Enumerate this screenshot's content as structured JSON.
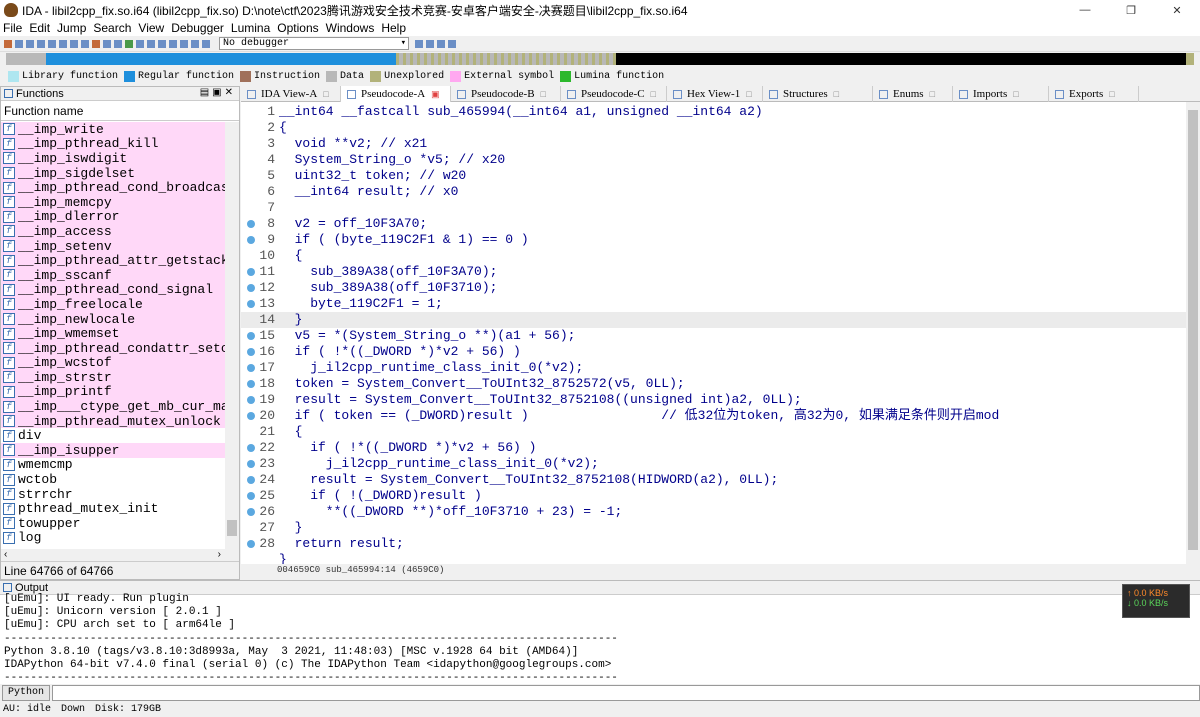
{
  "window": {
    "title": "IDA - libil2cpp_fix.so.i64 (libil2cpp_fix.so) D:\\note\\ctf\\2023腾讯游戏安全技术竞赛-安卓客户端安全-决赛题目\\libil2cpp_fix.so.i64"
  },
  "menu": [
    "File",
    "Edit",
    "Jump",
    "Search",
    "View",
    "Debugger",
    "Lumina",
    "Options",
    "Windows",
    "Help"
  ],
  "toolbar": {
    "debugger_select": "No debugger"
  },
  "legend": [
    {
      "label": "Library function",
      "color": "#aee6f0"
    },
    {
      "label": "Regular function",
      "color": "#1e8fdc"
    },
    {
      "label": "Instruction",
      "color": "#a0705a"
    },
    {
      "label": "Data",
      "color": "#b8b8b8"
    },
    {
      "label": "Unexplored",
      "color": "#b2b27a"
    },
    {
      "label": "External symbol",
      "color": "#ffa8f0"
    },
    {
      "label": "Lumina function",
      "color": "#2cb82c"
    }
  ],
  "functions_panel": {
    "title": "Functions",
    "column": "Function name",
    "items": [
      "__imp_write",
      "__imp_pthread_kill",
      "__imp_iswdigit",
      "__imp_sigdelset",
      "__imp_pthread_cond_broadcast",
      "__imp_memcpy",
      "__imp_dlerror",
      "__imp_access",
      "__imp_setenv",
      "__imp_pthread_attr_getstack",
      "__imp_sscanf",
      "__imp_pthread_cond_signal",
      "__imp_freelocale",
      "__imp_newlocale",
      "__imp_wmemset",
      "__imp_pthread_condattr_setcl",
      "__imp_wcstof",
      "__imp_strstr",
      "__imp_printf",
      "__imp___ctype_get_mb_cur_max",
      "__imp_pthread_mutex_unlock",
      "div",
      "__imp_isupper",
      "wmemcmp",
      "wctob",
      "strrchr",
      "pthread_mutex_init",
      "towupper",
      "log"
    ],
    "status": "Line 64766 of 64766"
  },
  "tabs": [
    {
      "label": "IDA View-A"
    },
    {
      "label": "Pseudocode-A"
    },
    {
      "label": "Pseudocode-B"
    },
    {
      "label": "Pseudocode-C"
    },
    {
      "label": "Hex View-1"
    },
    {
      "label": "Structures"
    },
    {
      "label": "Enums"
    },
    {
      "label": "Imports"
    },
    {
      "label": "Exports"
    }
  ],
  "code_lines": [
    {
      "n": "1",
      "t": "__int64 __fastcall sub_465994(__int64 a1, unsigned __int64 a2)"
    },
    {
      "n": "2",
      "t": "{"
    },
    {
      "n": "3",
      "t": "  void **v2; // x21"
    },
    {
      "n": "4",
      "t": "  System_String_o *v5; // x20"
    },
    {
      "n": "5",
      "t": "  uint32_t token; // w20"
    },
    {
      "n": "6",
      "t": "  __int64 result; // x0"
    },
    {
      "n": "7",
      "t": ""
    },
    {
      "n": "8",
      "t": "  v2 = off_10F3A70;"
    },
    {
      "n": "9",
      "t": "  if ( (byte_119C2F1 & 1) == 0 )"
    },
    {
      "n": "10",
      "t": "  {"
    },
    {
      "n": "11",
      "t": "    sub_389A38(off_10F3A70);"
    },
    {
      "n": "12",
      "t": "    sub_389A38(off_10F3710);"
    },
    {
      "n": "13",
      "t": "    byte_119C2F1 = 1;"
    },
    {
      "n": "14",
      "t": "  }"
    },
    {
      "n": "15",
      "t": "  v5 = *(System_String_o **)(a1 + 56);"
    },
    {
      "n": "16",
      "t": "  if ( !*((_DWORD *)*v2 + 56) )"
    },
    {
      "n": "17",
      "t": "    j_il2cpp_runtime_class_init_0(*v2);"
    },
    {
      "n": "18",
      "t": "  token = System_Convert__ToUInt32_8752572(v5, 0LL);"
    },
    {
      "n": "19",
      "t": "  result = System_Convert__ToUInt32_8752108((unsigned int)a2, 0LL);"
    },
    {
      "n": "20",
      "t": "  if ( token == (_DWORD)result )                 // 低32位为token, 高32为0, 如果满足条件则开启mod"
    },
    {
      "n": "21",
      "t": "  {"
    },
    {
      "n": "22",
      "t": "    if ( !*((_DWORD *)*v2 + 56) )"
    },
    {
      "n": "23",
      "t": "      j_il2cpp_runtime_class_init_0(*v2);"
    },
    {
      "n": "24",
      "t": "    result = System_Convert__ToUInt32_8752108(HIDWORD(a2), 0LL);"
    },
    {
      "n": "25",
      "t": "    if ( !(_DWORD)result )"
    },
    {
      "n": "26",
      "t": "      **((_DWORD **)*off_10F3710 + 23) = -1;"
    },
    {
      "n": "27",
      "t": "  }"
    },
    {
      "n": "28",
      "t": "  return result;"
    },
    {
      "n": "",
      "t": "}"
    }
  ],
  "code_status": "004659C0 sub_465994:14 (4659C0)",
  "output_panel": {
    "title": "Output",
    "lines": [
      "[uEmu]: UI ready. Run plugin",
      "[uEmu]: Unicorn version [ 2.0.1 ]",
      "[uEmu]: CPU arch set to [ arm64le ]",
      "---------------------------------------------------------------------------------------------",
      "Python 3.8.10 (tags/v3.8.10:3d8993a, May  3 2021, 11:48:03) [MSC v.1928 64 bit (AMD64)]",
      "IDAPython 64-bit v7.4.0 final (serial 0) (c) The IDAPython Team <idapython@googlegroups.com>",
      "---------------------------------------------------------------------------------------------"
    ],
    "net_up": "↑ 0.0 KB/s",
    "net_down": "↓ 0.0 KB/s"
  },
  "python_button": "Python",
  "statusbar": {
    "au": "AU:  idle",
    "dir": "Down",
    "disk": "Disk: 179GB"
  }
}
